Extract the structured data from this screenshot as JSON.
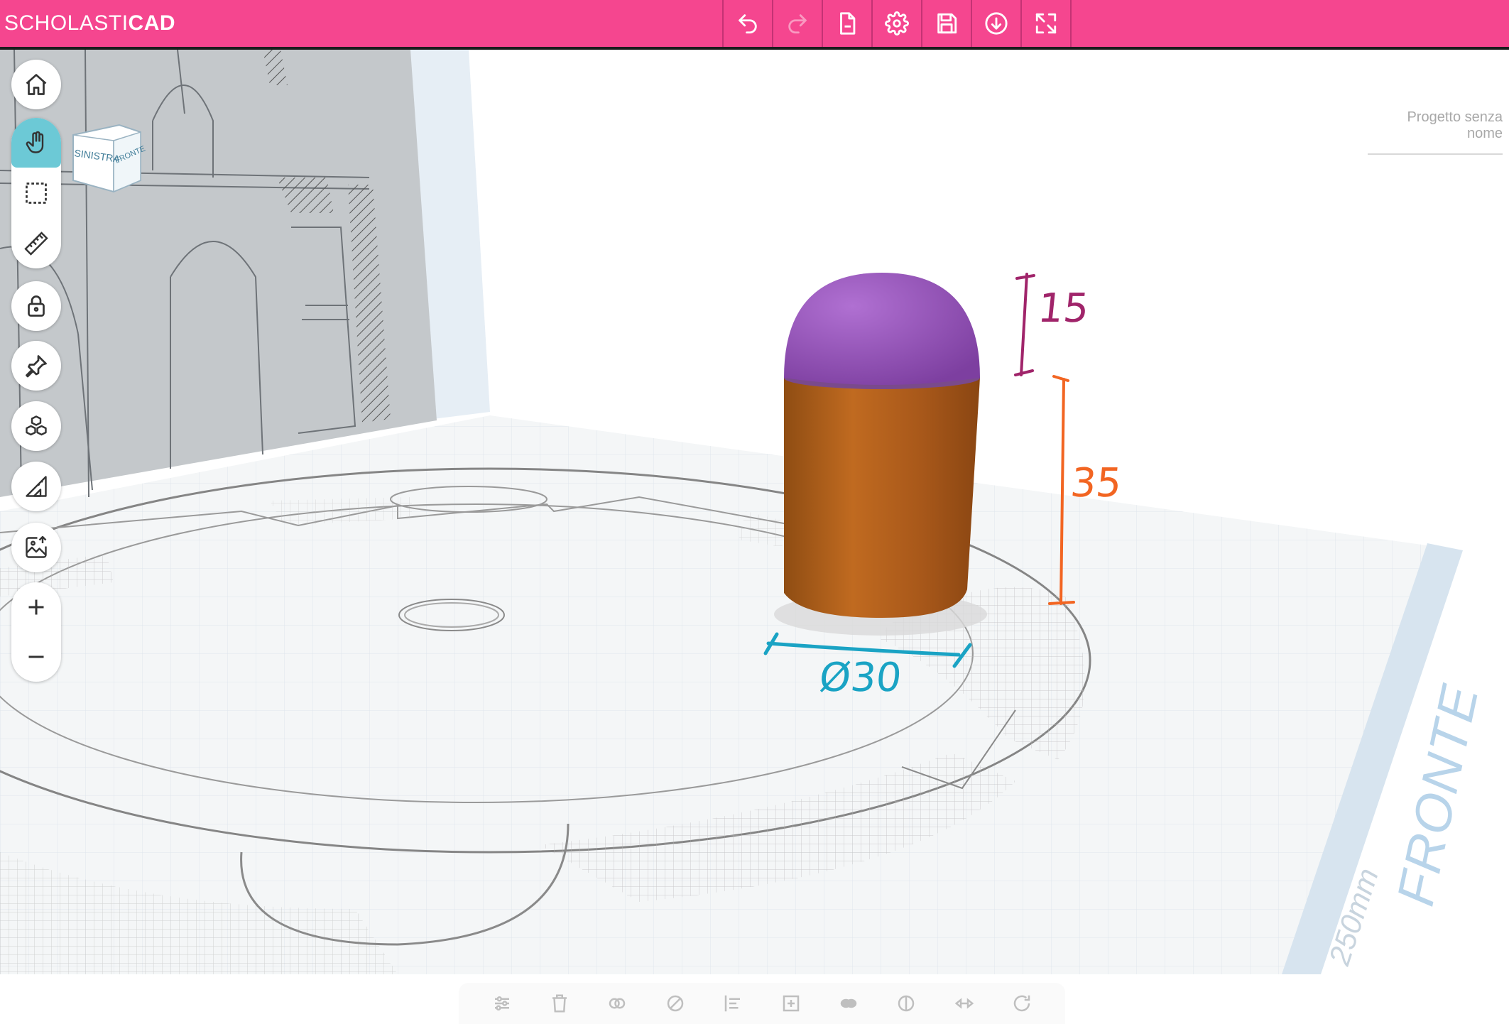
{
  "app": {
    "logo_light": "SCHOLASTI",
    "logo_bold": "CAD",
    "brand_color": "#f5468f"
  },
  "toolbar": {
    "buttons": [
      {
        "icon": "undo-icon",
        "enabled": true
      },
      {
        "icon": "redo-icon",
        "enabled": false
      },
      {
        "icon": "new-file-icon",
        "enabled": true
      },
      {
        "icon": "gear-icon",
        "enabled": true
      },
      {
        "icon": "save-icon",
        "enabled": true
      },
      {
        "icon": "download-icon",
        "enabled": true
      },
      {
        "icon": "fullscreen-icon",
        "enabled": true
      }
    ]
  },
  "viewcube": {
    "left_face": "SINISTRA",
    "front_face": "FRONTE"
  },
  "project": {
    "name": "Progetto senza nome"
  },
  "tools": [
    {
      "icon": "home-icon"
    },
    {
      "icon": "hand-pan-icon",
      "active": true
    },
    {
      "icon": "select-box-icon"
    },
    {
      "icon": "ruler-icon"
    },
    {
      "icon": "lock-icon"
    },
    {
      "icon": "pin-icon"
    },
    {
      "icon": "cubes-icon"
    },
    {
      "icon": "set-square-icon"
    },
    {
      "icon": "image-upload-icon"
    },
    {
      "icon": "zoom-in-icon"
    },
    {
      "icon": "zoom-out-icon"
    }
  ],
  "workplane": {
    "size_label": "250mm",
    "side_label": "FRONTE"
  },
  "annotations": {
    "dome_height": "15",
    "cylinder_height": "35",
    "diameter": "Ø30",
    "colors": {
      "dome": "#a24f9a",
      "cylinder": "#e36a1e",
      "diameter": "#1aa3c4"
    }
  },
  "model": {
    "dome_color": "#9b5bbd",
    "cylinder_color": "#b5641f"
  }
}
